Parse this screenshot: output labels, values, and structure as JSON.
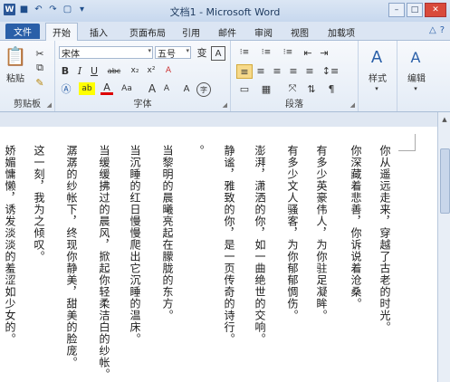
{
  "window": {
    "title": "文档1 - Microsoft Word",
    "word_icon": "W"
  },
  "quick_access": [
    {
      "icon": "save-icon",
      "glyph": "■"
    },
    {
      "icon": "undo-icon",
      "glyph": "↶"
    },
    {
      "icon": "redo-icon",
      "glyph": "↷"
    },
    {
      "icon": "print-preview-icon",
      "glyph": "▢"
    }
  ],
  "tabs": {
    "file": "文件",
    "items": [
      {
        "label": "开始",
        "active": true
      },
      {
        "label": "插入"
      },
      {
        "label": "页面布局"
      },
      {
        "label": "引用"
      },
      {
        "label": "邮件"
      },
      {
        "label": "审阅"
      },
      {
        "label": "视图"
      },
      {
        "label": "加载项"
      }
    ]
  },
  "ribbon": {
    "clipboard": {
      "label": "剪贴板",
      "paste": "粘贴"
    },
    "font": {
      "label": "字体",
      "font_name": "宋体",
      "font_size": "五号",
      "phonetic": "变",
      "border_char": "A",
      "bold": "B",
      "italic": "I",
      "underline": "U",
      "strike": "abc",
      "subscript": "x₂",
      "superscript": "x²",
      "grow": "A",
      "shrink": "A",
      "case": "Aa",
      "clear": "A",
      "enclose": "字"
    },
    "paragraph": {
      "label": "段落"
    },
    "styles": {
      "label": "样式",
      "glyph": "A"
    },
    "editing": {
      "label": "编辑",
      "glyph": "A"
    }
  },
  "document": {
    "columns": [
      "你从遥远走来，穿越了古老的时光。",
      "你深藏着悲善，你诉说着沧桑。",
      "有多少英豪伟人，为你驻足凝眸。",
      "有多少文人骚客，为你郁郁惆伤。",
      "澎湃，潇洒的你，如一曲绝世的交响。",
      "静谧，雅致的你，是一页传奇的诗行。",
      "。",
      "当黎明的晨曦亮起在朦胧的东方。",
      "当沉睡的红日慢慢爬出它沉睡的温床。",
      "当缓缓拂过的晨风，掀起你轻柔洁白的纱帐。",
      "潺潺的纱帐下，终现你静美，甜美的脸庞。",
      "这一刻，我为之倾叹。",
      "娇媚慵懒，诱发淡淡的羞涩如少女的。"
    ]
  }
}
